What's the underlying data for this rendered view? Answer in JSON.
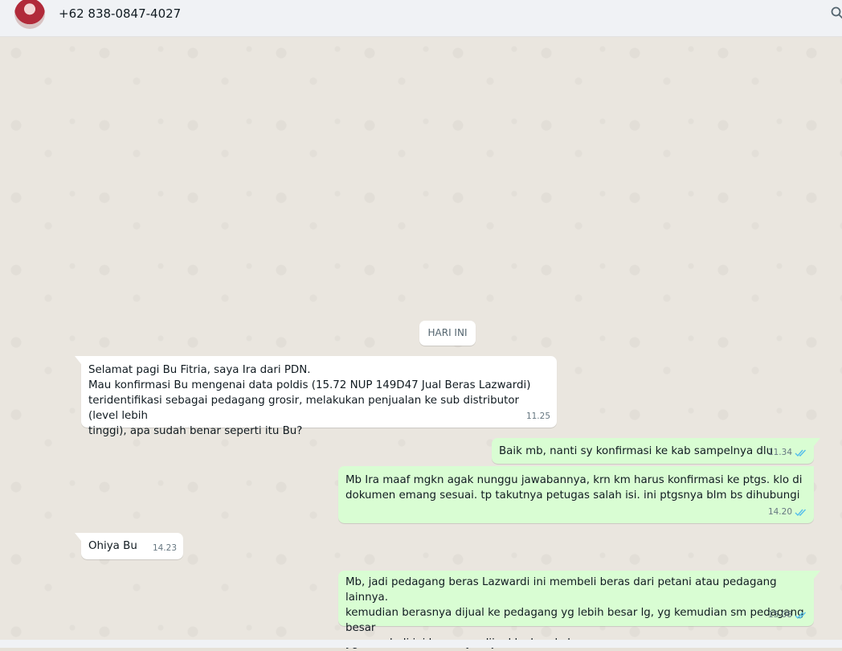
{
  "header": {
    "contact_name": "+62 838-0847-4027",
    "avatar_icon": "profile-avatar",
    "search_icon": "search-icon"
  },
  "chat": {
    "date_divider": "HARI INI",
    "messages": [
      {
        "direction": "incoming",
        "text": "Selamat pagi Bu Fitria, saya Ira dari PDN.\nMau konfirmasi Bu mengenai data poldis (15.72 NUP 149D47 Jual Beras Lazwardi)\nteridentifikasi sebagai pedagang grosir, melakukan penjualan ke sub distributor (level lebih\ntinggi), apa sudah benar seperti itu Bu?",
        "time": "11.25"
      },
      {
        "direction": "outgoing",
        "text": "Baik mb, nanti sy konfirmasi ke kab sampelnya dlu",
        "time": "11.34",
        "status": "read"
      },
      {
        "direction": "outgoing",
        "text": "Mb Ira maaf mgkn agak nunggu jawabannya, krn km harus konfirmasi ke ptgs. klo di\ndokumen emang sesuai. tp takutnya petugas salah isi. ini ptgsnya blm bs dihubungi",
        "time": "14.20",
        "status": "read"
      },
      {
        "direction": "incoming",
        "text": "Ohiya Bu",
        "time": "14.23"
      },
      {
        "direction": "outgoing",
        "text": "Mb, jadi pedagang beras Lazwardi ini membeli beras dari petani atau pedagang lainnya.\nkemudian berasnya dijual ke pedagang yg lebih besar lg, yg kemudian sm pedagang besar\nyg membeli ini berasnya dijual ke luar kab",
        "time": "15.08",
        "status": "read"
      }
    ]
  },
  "colors": {
    "incoming_bubble": "#ffffff",
    "outgoing_bubble": "#d9fdd3",
    "read_ticks": "#53bdeb",
    "chat_background": "#eae6df"
  }
}
